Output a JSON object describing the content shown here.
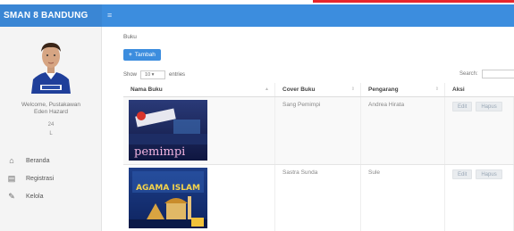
{
  "app": {
    "brand": "SMAN 8 BANDUNG",
    "menu_toggle": "≡"
  },
  "sidebar": {
    "avatar_icon": "user-avatar",
    "welcome": "Welcome, Pustakawan",
    "user_name": "Eden Hazard",
    "line_1": "24",
    "line_2": "L",
    "items": [
      {
        "label": "Beranda",
        "icon": "home-icon"
      },
      {
        "label": "Registrasi",
        "icon": "register-icon"
      },
      {
        "label": "Kelola",
        "icon": "edit-icon"
      }
    ]
  },
  "main": {
    "breadcrumb": "Buku",
    "add_button": "Tambah",
    "show_label": "Show",
    "entries_value": "10",
    "entries_label": "entries",
    "search_label": "Search:",
    "table": {
      "headers": [
        "Nama Buku",
        "Cover Buku",
        "Pengarang",
        "Aksi"
      ],
      "rows": [
        {
          "cover_title": "pemimpi",
          "cover_buku": "Sang Pemimpi",
          "pengarang": "Andrea Hirata",
          "edit": "Edit",
          "hapus": "Hapus"
        },
        {
          "cover_title": "AGAMA ISLAM",
          "cover_buku": "Sastra Sunda",
          "pengarang": "Sule",
          "edit": "Edit",
          "hapus": "Hapus"
        }
      ]
    }
  },
  "colors": {
    "topbar": "#3c8dde",
    "accent_red": "#e8262b",
    "sidebar_bg": "#f4f4f4"
  }
}
